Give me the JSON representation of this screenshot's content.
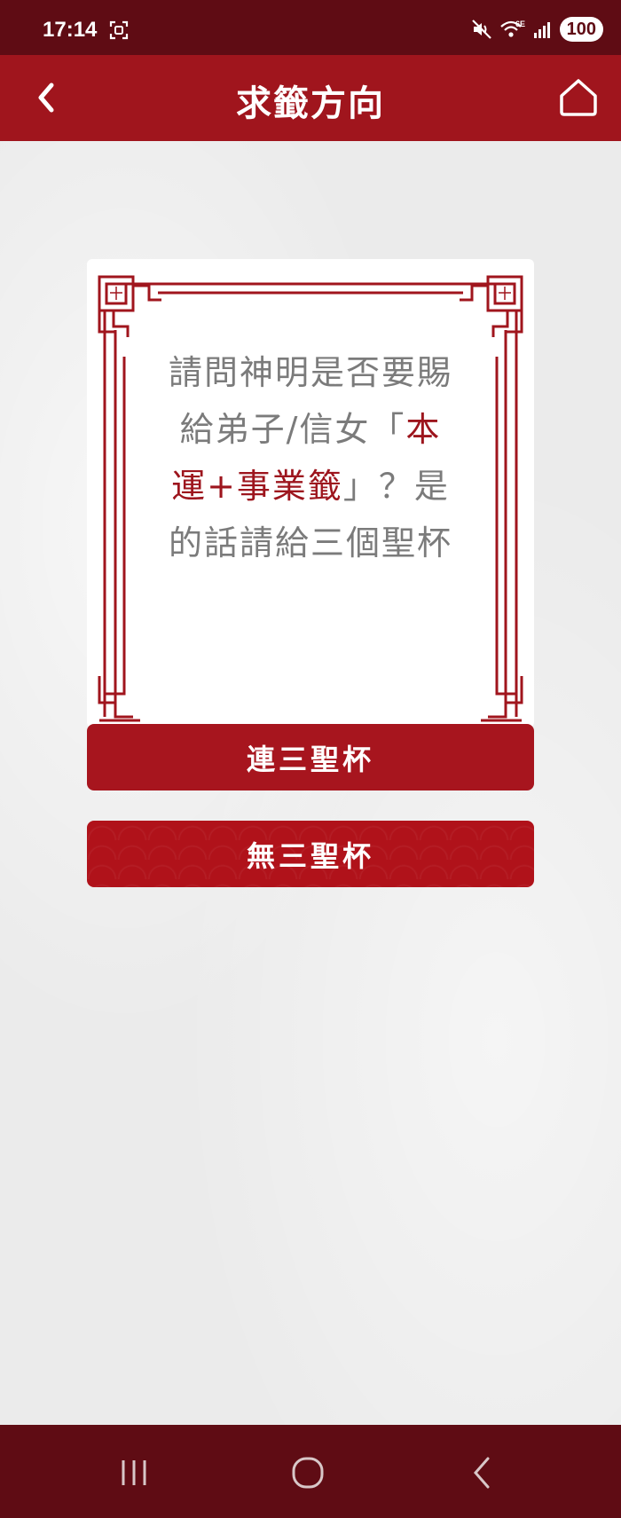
{
  "status_bar": {
    "time": "17:14",
    "battery": "100",
    "icons": [
      "screenshot-icon",
      "mute-icon",
      "wifi-6e-icon",
      "signal-icon",
      "battery-icon"
    ]
  },
  "header": {
    "title": "求籤方向",
    "back_icon": "chevron-left-icon",
    "home_icon": "home-icon"
  },
  "card": {
    "question": {
      "before": "請問神明是否要賜給弟子/信女「",
      "highlight": "本運+事業籤",
      "after": "」？是的話請給三個聖杯"
    }
  },
  "buttons": {
    "yes_label": "連三聖杯",
    "no_label": "無三聖杯"
  },
  "nav_bar": {
    "icons": [
      "recent-apps-icon",
      "home-circle-icon",
      "back-icon"
    ]
  },
  "colors": {
    "header_red": "#a0151d",
    "status_dark_red": "#5f0c14",
    "highlight_red": "#9d151d",
    "text_gray": "#7b7b7b",
    "background": "#ebebeb"
  }
}
